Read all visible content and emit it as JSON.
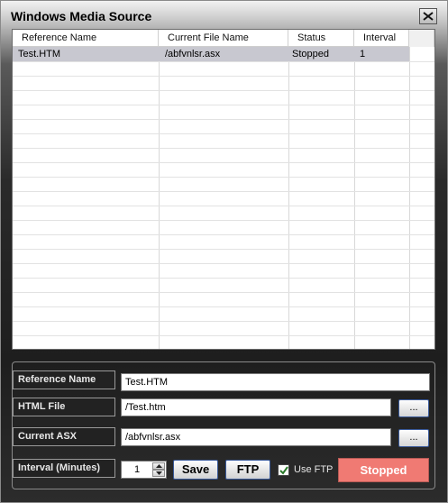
{
  "window": {
    "title": "Windows Media Source"
  },
  "grid": {
    "columns": [
      "Reference Name",
      "Current File Name",
      "Status",
      "Interval"
    ],
    "rows": [
      {
        "reference_name": "Test.HTM",
        "current_file_name": "/abfvnlsr.asx",
        "status": "Stopped",
        "interval": "1"
      }
    ]
  },
  "form": {
    "reference_name": {
      "label": "Reference Name",
      "value": "Test.HTM"
    },
    "html_file": {
      "label": "HTML File",
      "value": "/Test.htm",
      "browse_label": "..."
    },
    "current_asx": {
      "label": "Current  ASX",
      "value": "/abfvnlsr.asx",
      "browse_label": "..."
    },
    "interval": {
      "label": "Interval (Minutes)",
      "value": "1"
    },
    "save_label": "Save",
    "ftp_label": "FTP",
    "use_ftp": {
      "label": "Use FTP",
      "checked": true
    },
    "status_label": "Stopped"
  },
  "colors": {
    "status_bg": "#f07a73",
    "selected_row": "#c8c8d0"
  },
  "icons": {
    "close": "close-icon",
    "spin_up": "chevron-up-icon",
    "spin_down": "chevron-down-icon",
    "check": "checkmark-icon"
  }
}
